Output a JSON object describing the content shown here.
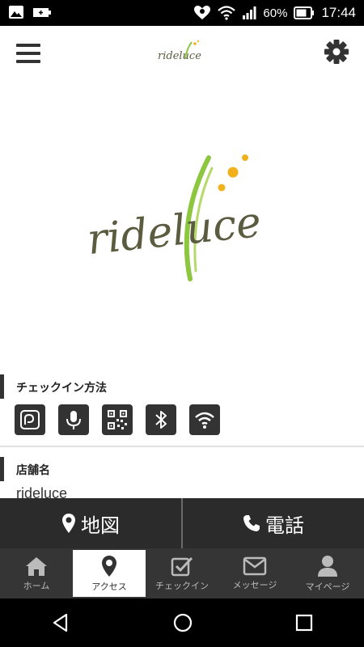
{
  "status_bar": {
    "battery_percent": "60%",
    "time": "17:44"
  },
  "app_bar": {
    "logo_text": "rideluce"
  },
  "hero": {
    "logo_text": "rideluce"
  },
  "checkin_section": {
    "title": "チェックイン方法",
    "methods": [
      "nfc-icon",
      "microphone-icon",
      "qr-code-icon",
      "bluetooth-icon",
      "wifi-icon"
    ]
  },
  "store_section": {
    "title": "店舗名",
    "value": "rideluce"
  },
  "action_bar": {
    "map_label": "地図",
    "phone_label": "電話"
  },
  "bottom_nav": {
    "items": [
      {
        "label": "ホーム",
        "icon": "home-icon"
      },
      {
        "label": "アクセス",
        "icon": "map-pin-icon",
        "active": true
      },
      {
        "label": "チェックイン",
        "icon": "checkbox-icon"
      },
      {
        "label": "メッセージ",
        "icon": "envelope-icon"
      },
      {
        "label": "マイページ",
        "icon": "person-icon"
      }
    ]
  },
  "colors": {
    "logo_text": "#5b5b40",
    "logo_leaf": "#8dc63f",
    "logo_dots": "#f0b11d",
    "action_bar": "#2b2b2b",
    "bottom_nav": "#353535"
  }
}
